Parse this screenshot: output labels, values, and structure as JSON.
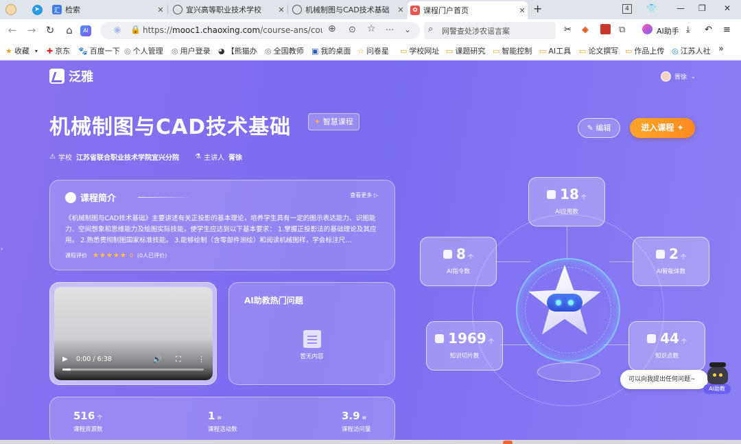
{
  "browser": {
    "tabs": [
      {
        "title": "检索",
        "favicon_color": "#3e7be6",
        "active": false
      },
      {
        "title": "宜兴高等职业技术学校",
        "favicon_color": "#555555",
        "active": false
      },
      {
        "title": "机械制图与CAD技术基础",
        "favicon_color": "#555555",
        "active": false
      },
      {
        "title": "课程门户首页",
        "favicon_color": "#e8544f",
        "active": true
      }
    ],
    "new_tab": "+",
    "tab_count": "4",
    "url_prefix": "https://",
    "url_host": "mooc1.chaoxing.com",
    "url_path": "/course-ans/cour",
    "search_placeholder": "网警查处涉农谣言案",
    "ai_assistant": "AI助手"
  },
  "bookmarks": [
    {
      "label": "收藏",
      "icon": "star-icon"
    },
    {
      "label": "京东",
      "icon": "jd-icon"
    },
    {
      "label": "百度一下",
      "icon": "baidu-icon"
    },
    {
      "label": "个人管理",
      "icon": "globe-icon"
    },
    {
      "label": "用户登录",
      "icon": "globe-icon"
    },
    {
      "label": "【熊猫办",
      "icon": "panda-icon"
    },
    {
      "label": "全国教师",
      "icon": "globe-icon"
    },
    {
      "label": "我的桌面",
      "icon": "desk-icon"
    },
    {
      "label": "问卷星",
      "icon": "star-outline-icon"
    },
    {
      "label": "学校网址",
      "icon": "folder-icon"
    },
    {
      "label": "课题研究",
      "icon": "folder-icon"
    },
    {
      "label": "智能控制",
      "icon": "folder-icon"
    },
    {
      "label": "AI工具",
      "icon": "folder-icon"
    },
    {
      "label": "论文撰写",
      "icon": "folder-icon"
    },
    {
      "label": "作品上传",
      "icon": "folder-icon"
    },
    {
      "label": "江苏人社",
      "icon": "globe-icon"
    }
  ],
  "page": {
    "brand": "泛雅",
    "user_name": "胥徐",
    "course_title": "机械制图与CAD技术基础",
    "smart_tag": "智慧课程",
    "school_label": "学校",
    "school_value": "江苏省联合职业技术学院宜兴分院",
    "lecturer_label": "主讲人",
    "lecturer_value": "胥徐",
    "edit_button": "编辑",
    "enter_button": "进入课程",
    "intro": {
      "heading": "课程简介",
      "more": "查看更多",
      "text": "《机械制图与CAD技术基础》主要讲述有关正投影的基本理论，培养学生具有一定的图示表达能力、识图能力、空间想象和思维能力及绘图实际技能，使学生应达到以下基本要求： 1.掌握正投影法的基础理论及其应用。 2.熟悉贯彻制图国家标准技能。 3.能够绘制（含零部件测绘）和阅读机械图样，学会标注尺…",
      "rating_label": "课程评价",
      "stars": "★★★★★",
      "score": "0",
      "rating_count": "(0人已评价)"
    },
    "video": {
      "time": "0:00 / 6:38",
      "progress": 0.0
    },
    "hot_questions": {
      "heading": "AI助教热门问题",
      "empty": "暂无内容"
    },
    "stats": [
      {
        "value": "516",
        "unit": "个",
        "label": "课程资源数"
      },
      {
        "value": "1",
        "unit": "w",
        "label": "课程活动数"
      },
      {
        "value": "3.9",
        "unit": "w",
        "label": "课程访问量"
      }
    ],
    "metrics": [
      {
        "value": "18",
        "unit": "个",
        "label": "AI应用数",
        "icon": "gear-icon"
      },
      {
        "value": "8",
        "unit": "个",
        "label": "AI指令数",
        "icon": "ai-chip-icon"
      },
      {
        "value": "2",
        "unit": "个",
        "label": "AI智能体数",
        "icon": "robot-icon"
      },
      {
        "value": "1969",
        "unit": "个",
        "label": "知识切片数",
        "icon": "slice-icon"
      },
      {
        "value": "44",
        "unit": "个",
        "label": "知识点数",
        "icon": "network-icon"
      }
    ],
    "ask_prompt": "可以向我提出任何问题~",
    "ai_tag": "AI助教"
  }
}
